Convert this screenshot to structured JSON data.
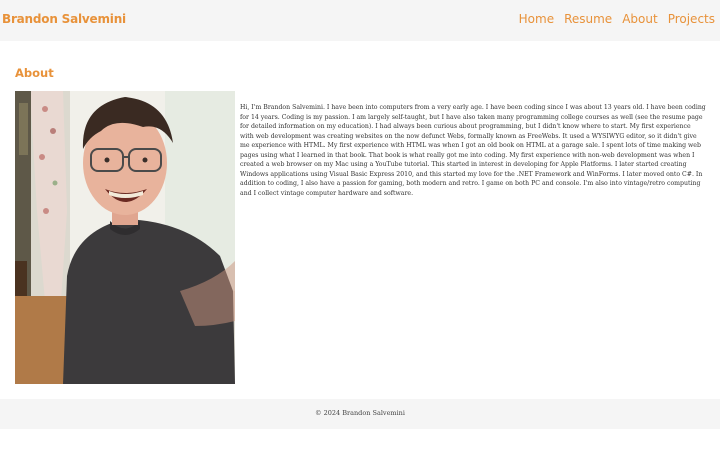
{
  "navbar": {
    "brand": "Brandon Salvemini",
    "links": [
      "Home",
      "Resume",
      "About",
      "Projects"
    ]
  },
  "page": {
    "heading": "About",
    "photo_icon": "profile-photo",
    "bio": "Hi, I'm Brandon Salvemini. I have been into computers from a very early age. I have been coding since I was about 13 years old. I have been coding for 14 years. Coding is my passion. I am largely self-taught, but I have also taken many programming college courses as well (see the resume page for detailed information on my education). I had always been curious about programming, but I didn't know where to start. My first experience with web development was creating websites on the now defunct Webs, formally known as FreeWebs. It used a WYSIWYG editor, so it didn't give me experience with HTML. My first experience with HTML was when I got an old book on HTML at a garage sale. I spent lots of time making web pages using what I learned in that book. That book is what really got me into coding. My first experience with non-web development was when I created a web browser on my Mac using a YouTube tutorial. This started in interest in developing for Apple Platforms. I later started creating Windows applications using Visual Basic Express 2010, and this started my love for the .NET Framework and WinForms. I later moved onto C#. In addition to coding, I also have a passion for gaming, both modern and retro. I game on both PC and console. I'm also into vintage/retro computing and I collect vintage computer hardware and software."
  },
  "footer": {
    "text": "© 2024 Brandon Salvemini"
  },
  "colors": {
    "accent": "#e8923a",
    "bar": "#f5f5f5"
  }
}
